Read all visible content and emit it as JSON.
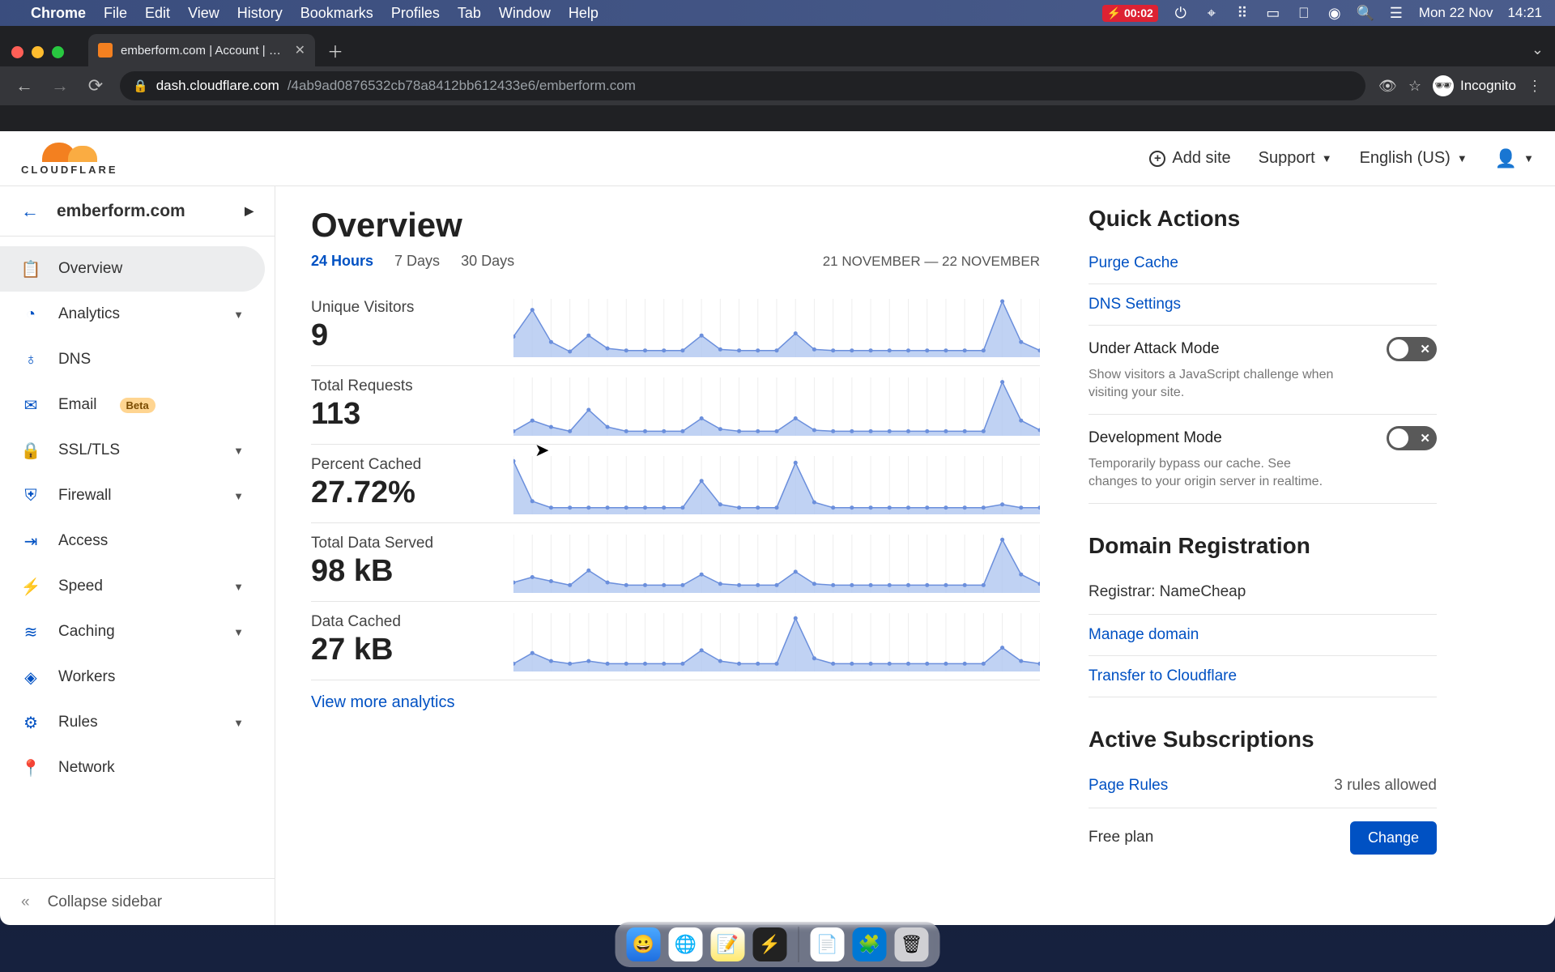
{
  "mac_menu": {
    "app": "Chrome",
    "items": [
      "File",
      "Edit",
      "View",
      "History",
      "Bookmarks",
      "Profiles",
      "Tab",
      "Window",
      "Help"
    ],
    "battery_text": "00:02",
    "date": "Mon 22 Nov",
    "time": "14:21"
  },
  "browser": {
    "tab_title": "emberform.com | Account | Clo",
    "url_host": "dash.cloudflare.com",
    "url_path": "/4ab9ad0876532cb78a8412bb612433e6/emberform.com",
    "incognito_label": "Incognito"
  },
  "header": {
    "add_site": "Add site",
    "support": "Support",
    "language": "English (US)"
  },
  "site_name": "emberform.com",
  "sidebar": {
    "items": [
      {
        "label": "Overview",
        "icon": "clipboard-icon",
        "active": true,
        "expandable": false
      },
      {
        "label": "Analytics",
        "icon": "clock-icon",
        "expandable": true
      },
      {
        "label": "DNS",
        "icon": "sitemap-icon",
        "expandable": false
      },
      {
        "label": "Email",
        "icon": "mail-icon",
        "badge": "Beta",
        "expandable": false
      },
      {
        "label": "SSL/TLS",
        "icon": "lock-icon",
        "expandable": true
      },
      {
        "label": "Firewall",
        "icon": "shield-icon",
        "expandable": true
      },
      {
        "label": "Access",
        "icon": "login-icon",
        "expandable": false
      },
      {
        "label": "Speed",
        "icon": "bolt-icon",
        "expandable": true
      },
      {
        "label": "Caching",
        "icon": "layers-icon",
        "expandable": true
      },
      {
        "label": "Workers",
        "icon": "code-icon",
        "expandable": false
      },
      {
        "label": "Rules",
        "icon": "sliders-icon",
        "expandable": true
      },
      {
        "label": "Network",
        "icon": "pin-icon",
        "expandable": false
      }
    ],
    "collapse": "Collapse sidebar"
  },
  "overview": {
    "title": "Overview",
    "ranges": [
      "24 Hours",
      "7 Days",
      "30 Days"
    ],
    "active_range": "24 Hours",
    "date_range": "21 NOVEMBER — 22 NOVEMBER",
    "metrics": [
      {
        "name": "Unique Visitors",
        "value": "9"
      },
      {
        "name": "Total Requests",
        "value": "113"
      },
      {
        "name": "Percent Cached",
        "value": "27.72%"
      },
      {
        "name": "Total Data Served",
        "value": "98 kB"
      },
      {
        "name": "Data Cached",
        "value": "27 kB"
      }
    ],
    "view_more": "View more analytics"
  },
  "chart_data": [
    {
      "type": "area",
      "title": "Unique Visitors",
      "ylim": [
        0,
        5
      ],
      "values": [
        1.7,
        4.2,
        1.2,
        0.3,
        1.8,
        0.6,
        0.4,
        0.4,
        0.4,
        0.4,
        1.8,
        0.5,
        0.4,
        0.4,
        0.4,
        2.0,
        0.5,
        0.4,
        0.4,
        0.4,
        0.4,
        0.4,
        0.4,
        0.4,
        0.4,
        0.4,
        5.0,
        1.2,
        0.4
      ]
    },
    {
      "type": "area",
      "title": "Total Requests",
      "ylim": [
        0,
        50
      ],
      "values": [
        2,
        12,
        6,
        2,
        22,
        6,
        2,
        2,
        2,
        2,
        14,
        4,
        2,
        2,
        2,
        14,
        3,
        2,
        2,
        2,
        2,
        2,
        2,
        2,
        2,
        2,
        48,
        12,
        3
      ]
    },
    {
      "type": "area",
      "title": "Percent Cached",
      "ylim": [
        0,
        100
      ],
      "values": [
        95,
        20,
        8,
        8,
        8,
        8,
        8,
        8,
        8,
        8,
        58,
        14,
        8,
        8,
        8,
        92,
        18,
        8,
        8,
        8,
        8,
        8,
        8,
        8,
        8,
        8,
        14,
        8,
        8
      ]
    },
    {
      "type": "area",
      "title": "Total Data Served",
      "ylim": [
        0,
        40
      ],
      "values": [
        6,
        10,
        7,
        4,
        15,
        6,
        4,
        4,
        4,
        4,
        12,
        5,
        4,
        4,
        4,
        14,
        5,
        4,
        4,
        4,
        4,
        4,
        4,
        4,
        4,
        4,
        38,
        12,
        5
      ]
    },
    {
      "type": "area",
      "title": "Data Cached",
      "ylim": [
        0,
        20
      ],
      "values": [
        2,
        6,
        3,
        2,
        3,
        2,
        2,
        2,
        2,
        2,
        7,
        3,
        2,
        2,
        2,
        19,
        4,
        2,
        2,
        2,
        2,
        2,
        2,
        2,
        2,
        2,
        8,
        3,
        2
      ]
    }
  ],
  "quick_actions": {
    "title": "Quick Actions",
    "purge": "Purge Cache",
    "dns": "DNS Settings",
    "attack_title": "Under Attack Mode",
    "attack_desc": "Show visitors a JavaScript challenge when visiting your site.",
    "dev_title": "Development Mode",
    "dev_desc": "Temporarily bypass our cache. See changes to your origin server in realtime."
  },
  "domain_reg": {
    "title": "Domain Registration",
    "registrar_label": "Registrar: NameCheap",
    "manage": "Manage domain",
    "transfer": "Transfer to Cloudflare"
  },
  "subscriptions": {
    "title": "Active Subscriptions",
    "page_rules": "Page Rules",
    "page_rules_note": "3 rules allowed",
    "plan": "Free plan",
    "change": "Change"
  }
}
